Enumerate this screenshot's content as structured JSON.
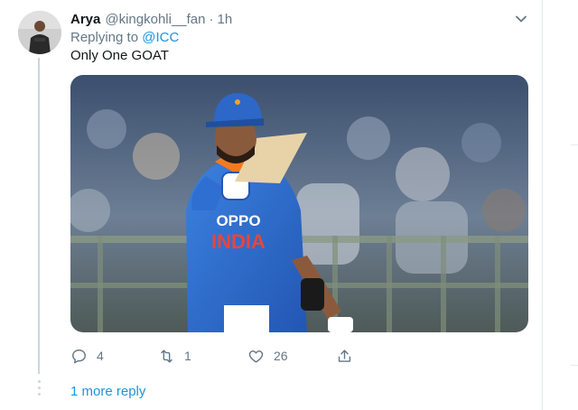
{
  "tweet": {
    "author_name": "Arya",
    "author_handle": "@kingkohli__fan",
    "separator": "·",
    "time": "1h",
    "replying_prefix": "Replying to",
    "replying_to": "@ICC",
    "text": "Only One GOAT",
    "media": {
      "jersey_sponsor": "OPPO",
      "jersey_team": "INDIA",
      "colors": {
        "jersey": "#2f6fd1",
        "cap": "#2d67c8",
        "accent_orange": "#f47a20"
      }
    },
    "actions": {
      "reply_count": "4",
      "retweet_count": "1",
      "like_count": "26"
    },
    "more_replies_label": "1 more reply"
  },
  "icons": {
    "caret": "chevron-down-icon",
    "reply": "reply-icon",
    "retweet": "retweet-icon",
    "like": "heart-icon",
    "share": "share-icon"
  },
  "colors": {
    "link": "#1b95e0",
    "secondary_text": "#657786",
    "thread_line": "#ccd6dd"
  }
}
